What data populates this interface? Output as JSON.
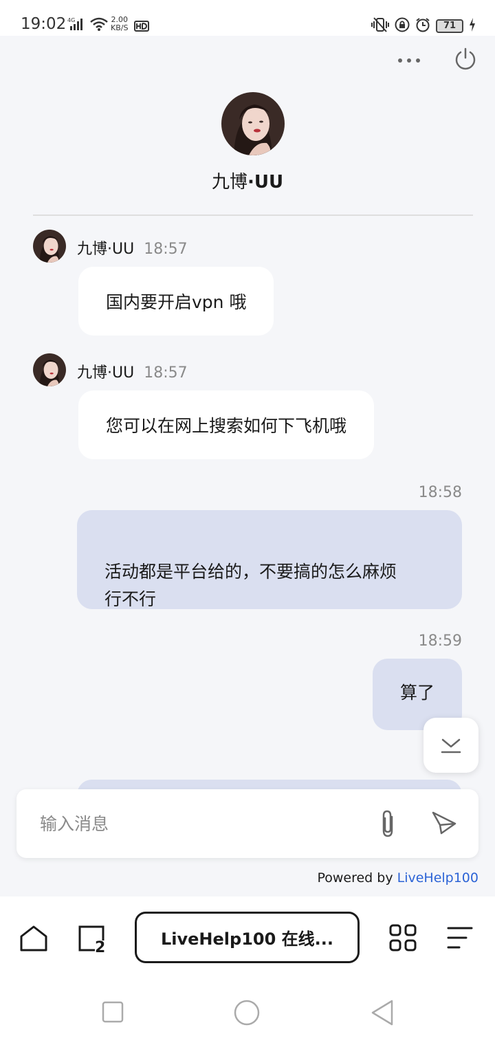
{
  "status_bar": {
    "time": "19:02",
    "network": "4G",
    "speed_value": "2.00",
    "speed_unit": "KB/S",
    "battery": "71"
  },
  "header": {
    "name_regular": "九博",
    "name_bold": "·UU",
    "more_icon": "more-horizontal-icon",
    "power_icon": "power-icon"
  },
  "messages": [
    {
      "direction": "in",
      "sender": "九博·UU",
      "time": "18:57",
      "text": "国内要开启vpn 哦"
    },
    {
      "direction": "in",
      "sender": "九博·UU",
      "time": "18:57",
      "text": "您可以在网上搜索如何下飞机哦"
    },
    {
      "direction": "out",
      "time": "18:58",
      "text": "活动都是平台给的，不要搞的怎么麻烦\n行不行"
    },
    {
      "direction": "out",
      "time": "18:59",
      "text": "算了"
    }
  ],
  "composer": {
    "placeholder": "输入消息",
    "attach_icon": "paperclip-icon",
    "send_icon": "send-icon"
  },
  "footer": {
    "powered_prefix": "Powered by ",
    "powered_link": "LiveHelp100"
  },
  "browser": {
    "title": "LiveHelp100 在线...",
    "tab_count": "2"
  },
  "colors": {
    "background": "#f5f6f9",
    "incoming_bubble": "#ffffff",
    "outgoing_bubble": "#dadff0",
    "link": "#2b63d6"
  }
}
